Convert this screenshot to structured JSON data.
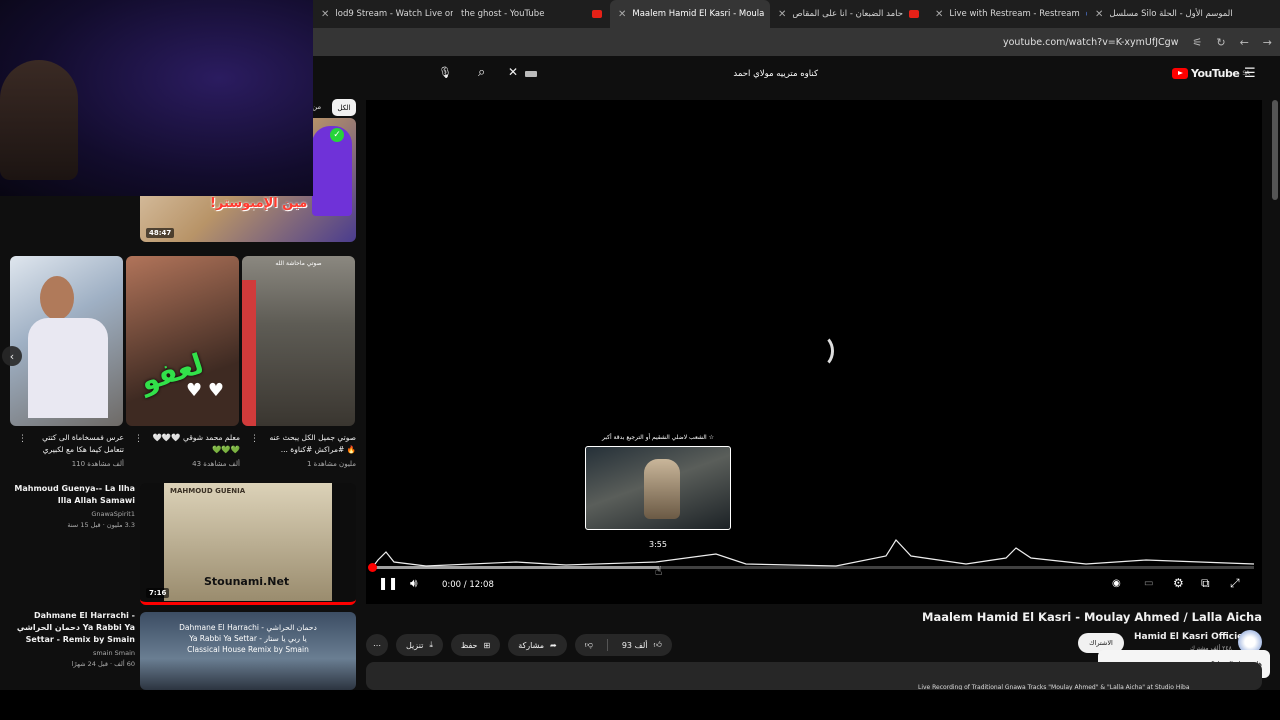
{
  "browser": {
    "tabs": [
      {
        "title": "lod9 Stream - Watch Live on Ki"
      },
      {
        "title": "the ghost - YouTube"
      },
      {
        "title": "Maalem Hamid El Kasri - Moula"
      },
      {
        "title": "حامد الضبعان - انا على المقاص"
      },
      {
        "title": "Live with Restream - Restream"
      },
      {
        "title": "مسلسل Silo الموسم الأول - الحلة"
      }
    ],
    "url": "youtube.com/watch?v=K-xymUfJCgw"
  },
  "masthead": {
    "search_query": "كناوه مترييه مولاي احمد",
    "logo_text": "YouTube",
    "logo_region": "SA"
  },
  "player": {
    "preview_title": "الشعب لاضلي الشقيم أو الترجيع بدقة أكبر ☆",
    "preview_time": "3:55",
    "time_display": "0:00 / 12:08",
    "buffered_fraction": 0.325,
    "played_fraction": 0.0
  },
  "video": {
    "title": "Maalem Hamid El Kasri - Moulay Ahmed / Lalla Aicha",
    "channel": "Hamid El Kasri Officiel",
    "channel_subs": "٢٤٨ ألف مشترك",
    "subscribe_label": "الاشتراك",
    "like_count": "93 ألف",
    "share_label": "مشاركة",
    "save_label": "حفظ",
    "download_label": "تنزيل",
    "tooltip": "هل يعجبك التمثيل؟",
    "description": "Live Recording of Traditional Gnawa Tracks \"Moulay Ahmed\" & \"Lalla Aicha\" at Studio Hiba"
  },
  "sidebar": {
    "chip_all": "الكل",
    "chip_other": "من",
    "top_video": {
      "duration": "48:47",
      "thumb_text": "مين الإمبوستر!"
    },
    "shorts": [
      {
        "title": "عرس فمسخاماة الى كتتي تتعامل كيما هكا مع لكبيري",
        "views": "110 ألف مشاهدة"
      },
      {
        "title": "معلم محمد شوقي 🤍🤍🤍 💚💚💚",
        "views": "43 ألف مشاهدة"
      },
      {
        "title": "صوتي جميل الكل يبحث عنه 🔥 #مراكش #كناوة ...",
        "views": "1 مليون مشاهدة"
      }
    ],
    "short_overlay": "لعفو",
    "short3_overlay": "صوتي ماحاشة الله",
    "rec1": {
      "title": "Mahmoud Guenya-- La Ilha Illa Allah Samawi",
      "channel": "GnawaSpirit1",
      "meta": "3.3 مليون · قبل 15 سنة",
      "duration": "7:16",
      "thumb_text": "Stounami.Net",
      "thumb_top": "MAHMOUD GUENIA"
    },
    "rec2": {
      "title": "Dahmane El Harrachi - دحمان الحراشي Ya Rabbi Ya Settar - Remix by Smain",
      "channel": "smain Smain",
      "meta": "60 ألف · قبل 24 شهرًا",
      "thumb_line1": "Dahmane El Harrachi - دحمان الحراشي",
      "thumb_line2": "Ya Rabbi Ya Settar - يا ربي يا ستار",
      "thumb_line3": "Classical House Remix by Smain"
    }
  },
  "icons": [
    "close-icon",
    "mic-icon",
    "search-icon",
    "keyboard-icon",
    "menu-icon",
    "pause-icon",
    "volume-icon",
    "autoplay-icon",
    "subtitles-icon",
    "settings-icon",
    "miniplayer-icon",
    "fullscreen-icon",
    "more-icon",
    "download-icon",
    "save-icon",
    "share-icon",
    "dislike-icon",
    "like-icon",
    "reload-icon",
    "back-icon",
    "forward-icon",
    "chevron-left-icon"
  ]
}
